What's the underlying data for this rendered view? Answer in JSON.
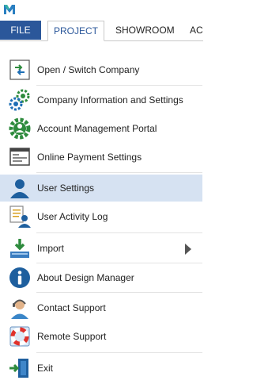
{
  "tabs": {
    "file": "FILE",
    "project": "PROJECT",
    "showroom": "SHOWROOM",
    "more": "AC"
  },
  "menu": {
    "items": [
      {
        "label": "Open / Switch Company",
        "icon": "open-switch-company-icon"
      },
      {
        "label": "Company Information and Settings",
        "icon": "company-settings-gears-icon"
      },
      {
        "label": "Account Management Portal",
        "icon": "account-portal-gear-icon"
      },
      {
        "label": "Online Payment Settings",
        "icon": "online-payment-window-icon"
      },
      {
        "label": "User Settings",
        "icon": "user-icon",
        "selected": true
      },
      {
        "label": "User Activity Log",
        "icon": "user-activity-log-icon"
      },
      {
        "label": "Import",
        "icon": "import-download-icon",
        "submenu": true
      },
      {
        "label": "About Design Manager",
        "icon": "info-icon"
      },
      {
        "label": "Contact Support",
        "icon": "contact-support-icon"
      },
      {
        "label": "Remote Support",
        "icon": "lifebuoy-icon"
      },
      {
        "label": "Exit",
        "icon": "exit-door-icon"
      }
    ]
  },
  "colors": {
    "file_tab": "#2b579a",
    "selected_row": "#d6e2f2",
    "icon_blue": "#1e6fb5",
    "icon_green": "#2e8b3d"
  }
}
